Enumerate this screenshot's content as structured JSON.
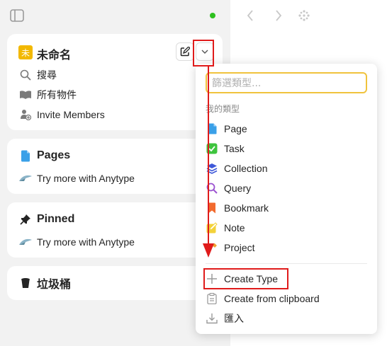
{
  "workspace": {
    "avatar_letter": "未",
    "name": "未命名",
    "nav": [
      {
        "label": "搜尋",
        "icon": "search-icon"
      },
      {
        "label": "所有物件",
        "icon": "book-icon"
      },
      {
        "label": "Invite Members",
        "icon": "invite-members-icon"
      }
    ]
  },
  "widgets": [
    {
      "title": "Pages",
      "icon": "page-icon",
      "hint": "Try more with Anytype"
    },
    {
      "title": "Pinned",
      "icon": "pin-icon",
      "hint": "Try more with Anytype"
    },
    {
      "title": "垃圾桶",
      "icon": "trash-icon"
    }
  ],
  "status": {
    "color": "#2ec01f"
  },
  "menu": {
    "search_placeholder": "篩選類型...",
    "section_title": "我的類型",
    "types": [
      {
        "label": "Page",
        "icon": "page-type-icon",
        "color": "#3aa0e8"
      },
      {
        "label": "Task",
        "icon": "task-checkbox-icon",
        "color": "#3ec43e"
      },
      {
        "label": "Collection",
        "icon": "collection-layers-icon",
        "color": "#3e58d8"
      },
      {
        "label": "Query",
        "icon": "query-search-icon",
        "color": "#9b52d0"
      },
      {
        "label": "Bookmark",
        "icon": "bookmark-icon",
        "color": "#f26a2e"
      },
      {
        "label": "Note",
        "icon": "note-pencil-icon",
        "color": "#f3d23a"
      },
      {
        "label": "Project",
        "icon": "project-hammer-icon",
        "color": "#f0a030"
      }
    ],
    "actions": [
      {
        "label": "Create Type",
        "icon": "plus-icon"
      },
      {
        "label": "Create from clipboard",
        "icon": "clipboard-icon"
      },
      {
        "label": "匯入",
        "icon": "import-icon"
      }
    ]
  },
  "colors": {
    "annotation": "#e01b1b",
    "search_focus": "#f0c33d",
    "avatar_bg": "#f2b800"
  }
}
